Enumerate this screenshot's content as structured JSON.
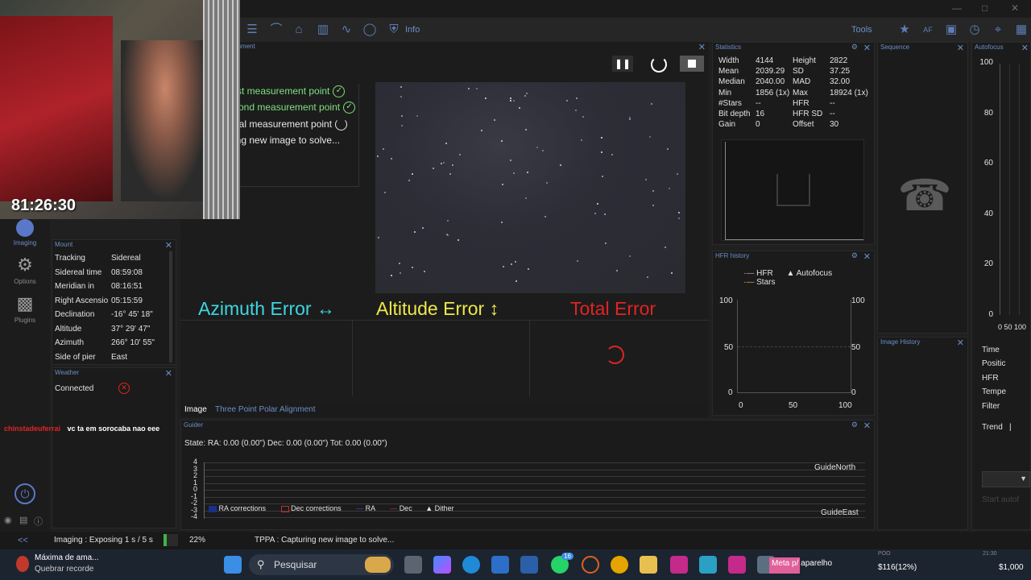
{
  "toolbar": {
    "info_label": "Info",
    "tools_label": "Tools"
  },
  "webcam": {
    "timer": "81:26:30"
  },
  "nav": {
    "imaging": "Imaging",
    "options": "Options",
    "plugins": "Plugins"
  },
  "tppa": {
    "panel_title": "gnment",
    "steps": [
      "rst measurement point",
      "cond measurement point",
      "nal measurement point",
      "ing new image to solve..."
    ],
    "azimuth_label": "Azimuth Error",
    "altitude_label": "Altitude Error",
    "total_label": "Total Error",
    "colors": {
      "azimuth": "#3fd6e0",
      "altitude": "#ede84a",
      "total": "#e02424",
      "done": "#7ee07e"
    }
  },
  "tabs": {
    "image": "Image",
    "tppa": "Three Point Polar Alignment"
  },
  "statistics": {
    "title": "Statistics",
    "rows": [
      {
        "l1": "Width",
        "v1": "4144",
        "l2": "Height",
        "v2": "2822"
      },
      {
        "l1": "Mean",
        "v1": "2039.29",
        "l2": "SD",
        "v2": "37.25"
      },
      {
        "l1": "Median",
        "v1": "2040.00",
        "l2": "MAD",
        "v2": "32.00"
      },
      {
        "l1": "Min",
        "v1": "1856 (1x)",
        "l2": "Max",
        "v2": "18924 (1x)"
      },
      {
        "l1": "#Stars",
        "v1": "--",
        "l2": "HFR",
        "v2": "--"
      },
      {
        "l1": "Bit depth",
        "v1": "16",
        "l2": "HFR SD",
        "v2": "--"
      },
      {
        "l1": "Gain",
        "v1": "0",
        "l2": "Offset",
        "v2": "30"
      }
    ]
  },
  "sequence": {
    "title": "Sequence"
  },
  "autofocus": {
    "title": "Autofocus",
    "y_ticks": [
      "100",
      "80",
      "60",
      "40",
      "20",
      "0"
    ],
    "x_ticks": "0 50 100",
    "fields": [
      "Time",
      "Positic",
      "HFR",
      "Tempe",
      "Filter",
      "Trend"
    ],
    "trend_value": "|",
    "start_label": "Start autof"
  },
  "hfr_history": {
    "title": "HFR history",
    "legend_hfr": "HFR",
    "legend_autofocus": "Autofocus",
    "legend_stars": "Stars",
    "y_left": [
      "100",
      "50",
      "0"
    ],
    "y_right": [
      "100",
      "50",
      "0"
    ],
    "x_ticks": [
      "0",
      "50",
      "100"
    ]
  },
  "image_history": {
    "title": "Image History"
  },
  "mount": {
    "title": "Mount",
    "rows": [
      {
        "label": "Tracking",
        "value": "Sidereal"
      },
      {
        "label": "Sidereal time",
        "value": "08:59:08"
      },
      {
        "label": "Meridian in",
        "value": "08:16:51"
      },
      {
        "label": "Right Ascensio",
        "value": "05:15:59"
      },
      {
        "label": "Declination",
        "value": "-16° 45' 18\""
      },
      {
        "label": "Altitude",
        "value": "37° 29' 47\""
      },
      {
        "label": "Azimuth",
        "value": "266° 10' 55\""
      },
      {
        "label": "Side of pier",
        "value": "East"
      }
    ]
  },
  "weather": {
    "title": "Weather",
    "connected_label": "Connected"
  },
  "chat": {
    "user": "chinstadeuferrai",
    "message": "vc ta em sorocaba nao eee"
  },
  "guider": {
    "title": "Guider",
    "state": "State:  RA: 0.00 (0.00\")  Dec: 0.00 (0.00\")  Tot: 0.00 (0.00\")",
    "y_ticks": [
      "4",
      "3",
      "2",
      "1",
      "0",
      "-1",
      "-2",
      "-3",
      "-4"
    ],
    "north": "GuideNorth",
    "east": "GuideEast",
    "legend": [
      "RA corrections",
      "Dec corrections",
      "RA",
      "Dec",
      "Dither"
    ]
  },
  "status": {
    "imaging": "Imaging :   Exposing 1 s / 5 s",
    "progress_percent": "22%",
    "progress_value": 0.22,
    "tppa": "TPPA :   Capturing new image to solve..."
  },
  "taskbar": {
    "notif_title": "Máxima de ama...",
    "notif_sub": "Quebrar recorde",
    "search": "Pesquisar",
    "badge": "16",
    "meta": "Meta p/ aparelho",
    "ticker1": "$116(12%)",
    "ticker2": "$1,000",
    "mini1": "POO",
    "mini2": "21:30"
  }
}
